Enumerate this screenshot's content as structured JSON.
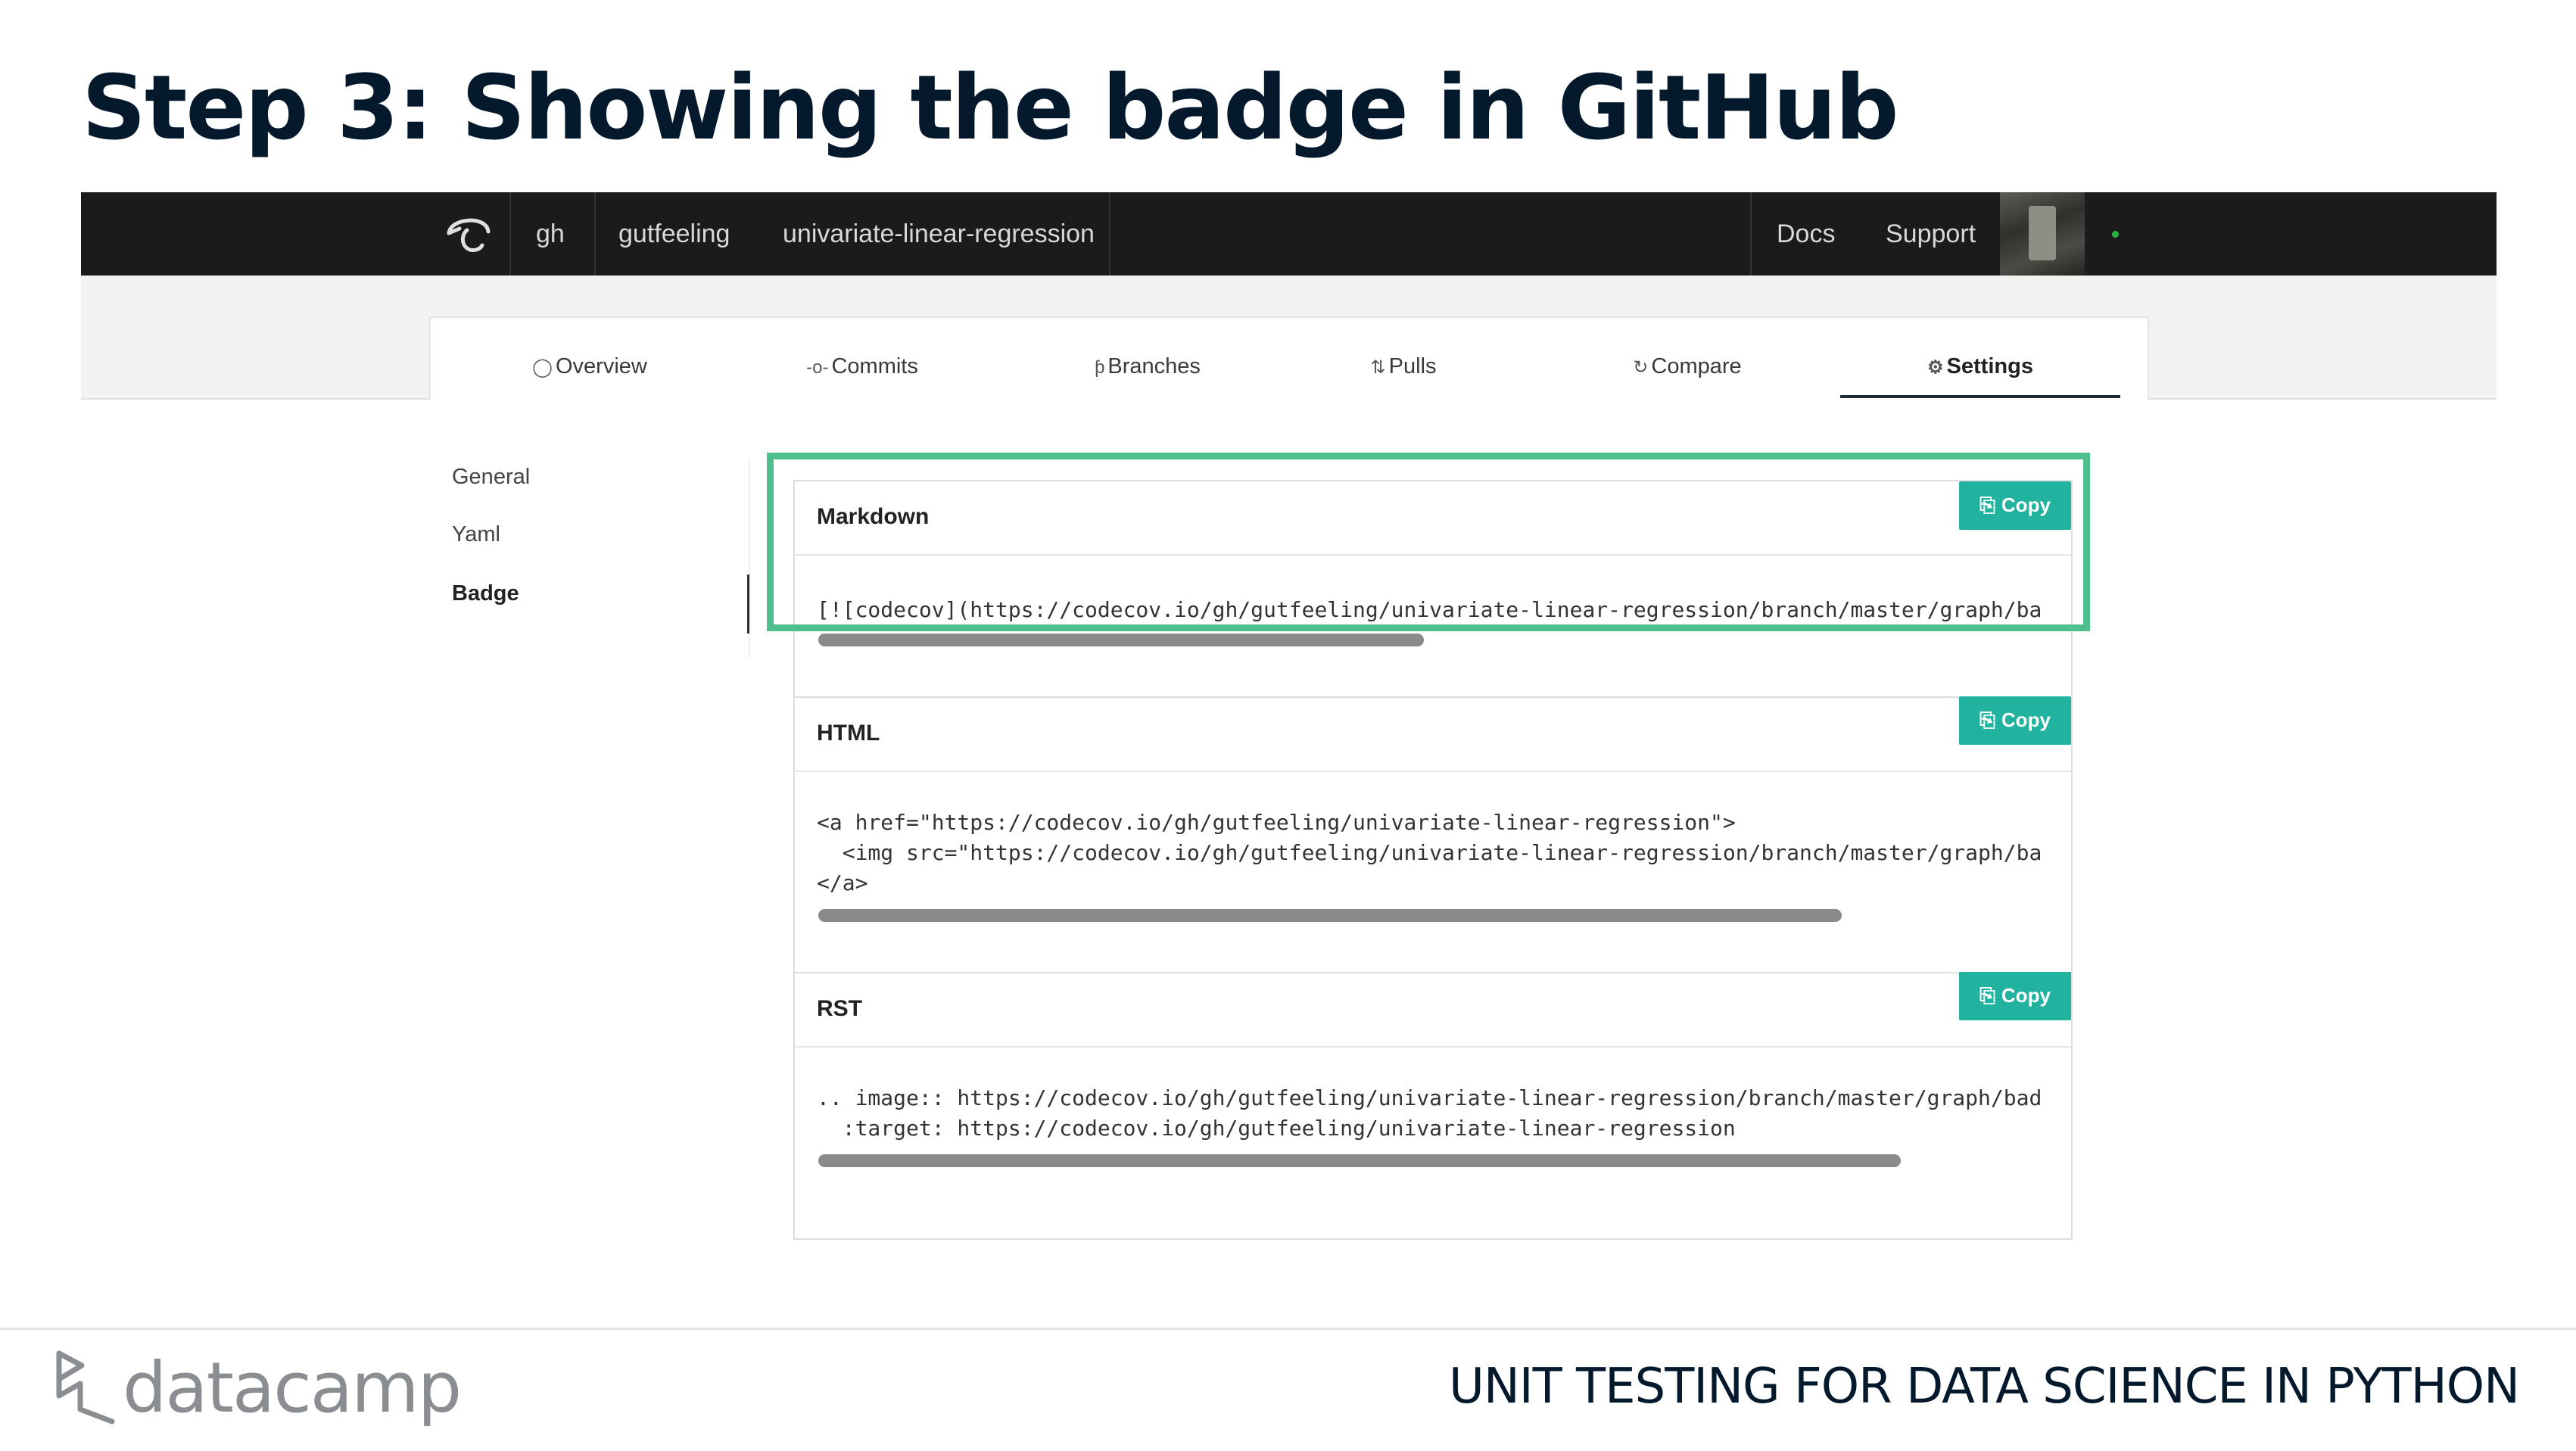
{
  "slide": {
    "title": "Step 3: Showing the badge in GitHub",
    "course_title": "UNIT TESTING FOR DATA SCIENCE IN PYTHON",
    "brand": "datacamp"
  },
  "topbar": {
    "breadcrumbs": [
      "gh",
      "gutfeeling",
      "univariate-linear-regression"
    ],
    "docs": "Docs",
    "support": "Support"
  },
  "tabs": [
    {
      "label": "Overview",
      "icon": "dashboard-icon"
    },
    {
      "label": "Commits",
      "icon": "commit-icon"
    },
    {
      "label": "Branches",
      "icon": "branch-icon"
    },
    {
      "label": "Pulls",
      "icon": "pull-request-icon"
    },
    {
      "label": "Compare",
      "icon": "compare-icon"
    },
    {
      "label": "Settings",
      "icon": "gear-icon",
      "active": true
    }
  ],
  "sidenav": {
    "items": [
      {
        "label": "General"
      },
      {
        "label": "Yaml"
      },
      {
        "label": "Badge",
        "active": true
      }
    ]
  },
  "badges": [
    {
      "title": "Markdown",
      "copy_label": "Copy",
      "code": "[![codecov](https://codecov.io/gh/gutfeeling/univariate-linear-regression/branch/master/graph/badge.svg)](https://codecov.io/gh/gutfeeling/univariate-linear-regression)"
    },
    {
      "title": "HTML",
      "copy_label": "Copy",
      "code_lines": [
        "<a href=\"https://codecov.io/gh/gutfeeling/univariate-linear-regression\">",
        "  <img src=\"https://codecov.io/gh/gutfeeling/univariate-linear-regression/branch/master/graph/badge.svg\" />",
        "</a>"
      ]
    },
    {
      "title": "RST",
      "copy_label": "Copy",
      "code_lines": [
        ".. image:: https://codecov.io/gh/gutfeeling/univariate-linear-regression/branch/master/graph/badge.svg",
        "  :target: https://codecov.io/gh/gutfeeling/univariate-linear-regression"
      ]
    }
  ],
  "colors": {
    "highlight": "#4ebf8d",
    "copy_button": "#21b3a0",
    "topbar": "#1b1b1b",
    "title": "#05192d"
  }
}
